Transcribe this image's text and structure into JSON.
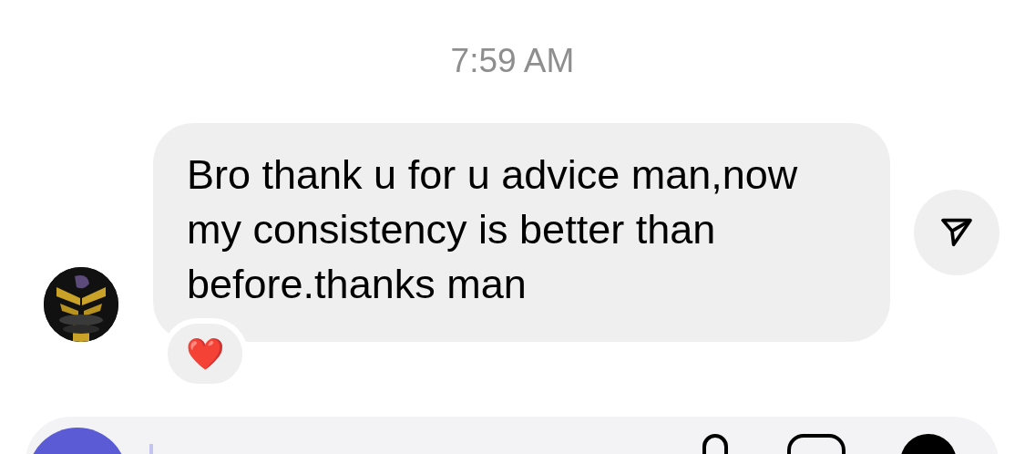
{
  "timestamp": "7:59 AM",
  "message": {
    "text": "Bro thank u for u advice man,now my consistency is better than before.thanks man",
    "reaction": "❤️"
  }
}
